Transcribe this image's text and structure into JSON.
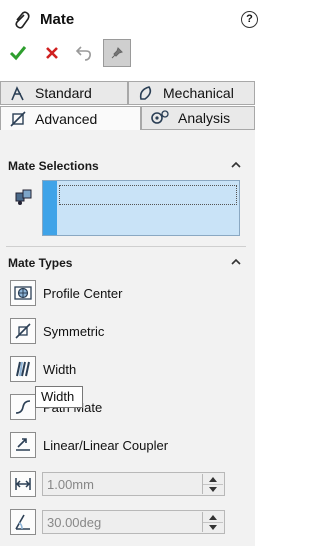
{
  "header": {
    "title": "Mate",
    "help_label": "?"
  },
  "tabs": [
    {
      "label": "Standard",
      "icon": "standard-mate-icon"
    },
    {
      "label": "Mechanical",
      "icon": "mechanical-mate-icon"
    },
    {
      "label": "Advanced",
      "icon": "advanced-mate-icon",
      "selected": true
    },
    {
      "label": "Analysis",
      "icon": "analysis-gear-icon"
    }
  ],
  "mate_selections": {
    "heading": "Mate Selections"
  },
  "mate_types": {
    "heading": "Mate Types",
    "items": [
      {
        "label": "Profile Center",
        "icon": "profile-center-icon"
      },
      {
        "label": "Symmetric",
        "icon": "symmetric-icon"
      },
      {
        "label": "Width",
        "icon": "width-icon"
      },
      {
        "label": "Path Mate",
        "icon": "path-mate-icon"
      },
      {
        "label": "Linear/Linear Coupler",
        "icon": "linear-coupler-icon"
      }
    ],
    "distance_value": "1.00mm",
    "angle_value": "30.00deg"
  },
  "tooltip": {
    "text": "Width"
  },
  "colors": {
    "ok_green": "#2e9e2e",
    "cancel_red": "#d02020",
    "selection_blue": "#c9e3f7",
    "selection_accent": "#3fa3e8"
  }
}
